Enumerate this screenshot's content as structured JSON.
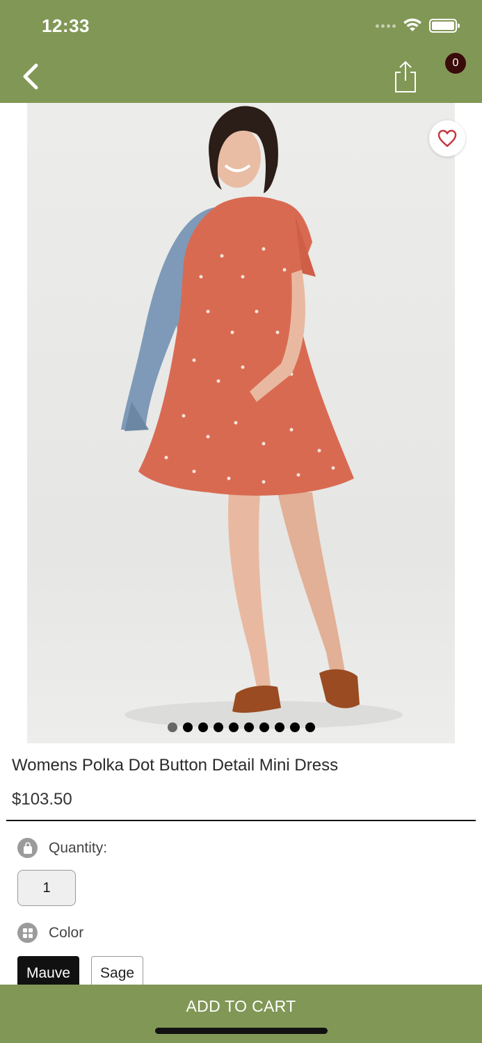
{
  "status_bar": {
    "time": "12:33"
  },
  "nav": {
    "cart_count": "0"
  },
  "icons": {
    "back": "chevron-left-icon",
    "share": "share-icon",
    "favorite": "heart-icon",
    "quantity": "bag-icon",
    "color": "grid-icon"
  },
  "gallery": {
    "dot_count": 10,
    "active_index": 0
  },
  "product": {
    "title": "Womens Polka Dot Button Detail Mini Dress",
    "price": "$103.50"
  },
  "quantity": {
    "label": "Quantity:",
    "value": "1"
  },
  "color": {
    "label": "Color",
    "options": [
      {
        "label": "Mauve",
        "selected": true
      },
      {
        "label": "Sage",
        "selected": false
      }
    ]
  },
  "footer": {
    "add_to_cart": "ADD TO CART"
  },
  "colors": {
    "brand_green": "#819756",
    "badge": "#3a0b0b",
    "heart": "#c8373f"
  }
}
